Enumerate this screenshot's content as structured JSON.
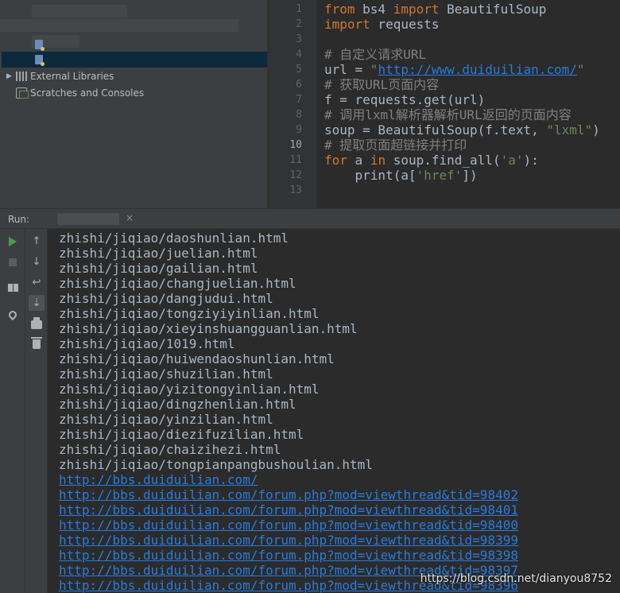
{
  "project_tree": {
    "external_libraries": "External Libraries",
    "scratches": "Scratches and Consoles"
  },
  "editor": {
    "current_line": 10,
    "line_numbers": [
      "1",
      "2",
      "3",
      "4",
      "5",
      "6",
      "7",
      "8",
      "9",
      "10",
      "11",
      "12",
      "13"
    ],
    "lines": {
      "l1": {
        "kw1": "from",
        "mid": " bs4 ",
        "kw2": "import",
        "rest": " BeautifulSoup"
      },
      "l2": {
        "kw": "import",
        "rest": " requests"
      },
      "l4": "# 自定义请求URL",
      "l5": {
        "pre": "url = ",
        "q1": "\"",
        "url": "http://www.duiduilian.com/",
        "q2": "\""
      },
      "l6": "# 获取URL页面内容",
      "l7": "f = requests.get(url)",
      "l8": "# 调用lxml解析器解析URL返回的页面内容",
      "l9": {
        "pre": "soup = BeautifulSoup(f.text, ",
        "str": "\"lxml\"",
        "post": ")"
      },
      "l10": "# 提取页面超链接并打印",
      "l11": {
        "kw1": "for",
        "a": " a ",
        "kw2": "in",
        "mid": " soup.find_all(",
        "str": "'a'",
        "post": "):"
      },
      "l12": {
        "pre": "    print(a[",
        "str": "'href'",
        "post": "])"
      }
    }
  },
  "run_panel": {
    "label": "Run:",
    "tab_close": "×",
    "output": [
      {
        "text": "zhishi/jiqiao/daoshunlian.html",
        "link": false
      },
      {
        "text": "zhishi/jiqiao/juelian.html",
        "link": false
      },
      {
        "text": "zhishi/jiqiao/gailian.html",
        "link": false
      },
      {
        "text": "zhishi/jiqiao/changjuelian.html",
        "link": false
      },
      {
        "text": "zhishi/jiqiao/dangjudui.html",
        "link": false
      },
      {
        "text": "zhishi/jiqiao/tongziyiyinlian.html",
        "link": false
      },
      {
        "text": "zhishi/jiqiao/xieyinshuangguanlian.html",
        "link": false
      },
      {
        "text": "zhishi/jiqiao/1019.html",
        "link": false
      },
      {
        "text": "zhishi/jiqiao/huiwendaoshunlian.html",
        "link": false
      },
      {
        "text": "zhishi/jiqiao/shuzilian.html",
        "link": false
      },
      {
        "text": "zhishi/jiqiao/yizitongyinlian.html",
        "link": false
      },
      {
        "text": "zhishi/jiqiao/dingzhenlian.html",
        "link": false
      },
      {
        "text": "zhishi/jiqiao/yinzilian.html",
        "link": false
      },
      {
        "text": "zhishi/jiqiao/diezifuzilian.html",
        "link": false
      },
      {
        "text": "zhishi/jiqiao/chaizihezi.html",
        "link": false
      },
      {
        "text": "zhishi/jiqiao/tongpianpangbushoulian.html",
        "link": false
      },
      {
        "text": "http://bbs.duiduilian.com/",
        "link": true
      },
      {
        "text": "http://bbs.duiduilian.com/forum.php?mod=viewthread&tid=98402",
        "link": true
      },
      {
        "text": "http://bbs.duiduilian.com/forum.php?mod=viewthread&tid=98401",
        "link": true
      },
      {
        "text": "http://bbs.duiduilian.com/forum.php?mod=viewthread&tid=98400",
        "link": true
      },
      {
        "text": "http://bbs.duiduilian.com/forum.php?mod=viewthread&tid=98399",
        "link": true
      },
      {
        "text": "http://bbs.duiduilian.com/forum.php?mod=viewthread&tid=98398",
        "link": true
      },
      {
        "text": "http://bbs.duiduilian.com/forum.php?mod=viewthread&tid=98397",
        "link": true
      },
      {
        "text": "http://bbs.duiduilian.com/forum.php?mod=viewthread&tid=98396",
        "link": true
      }
    ]
  },
  "toolbar_icons": {
    "run": "play-icon",
    "stop": "stop-icon",
    "up": "↑",
    "down": "↓",
    "wrap": "↩",
    "scroll_end": "⇣"
  },
  "watermark": "https://blog.csdn.net/dianyou8752",
  "colors": {
    "keyword": "#cc7832",
    "string": "#6a8759",
    "comment": "#808080",
    "link": "#287bde",
    "text": "#a9b7c6"
  }
}
